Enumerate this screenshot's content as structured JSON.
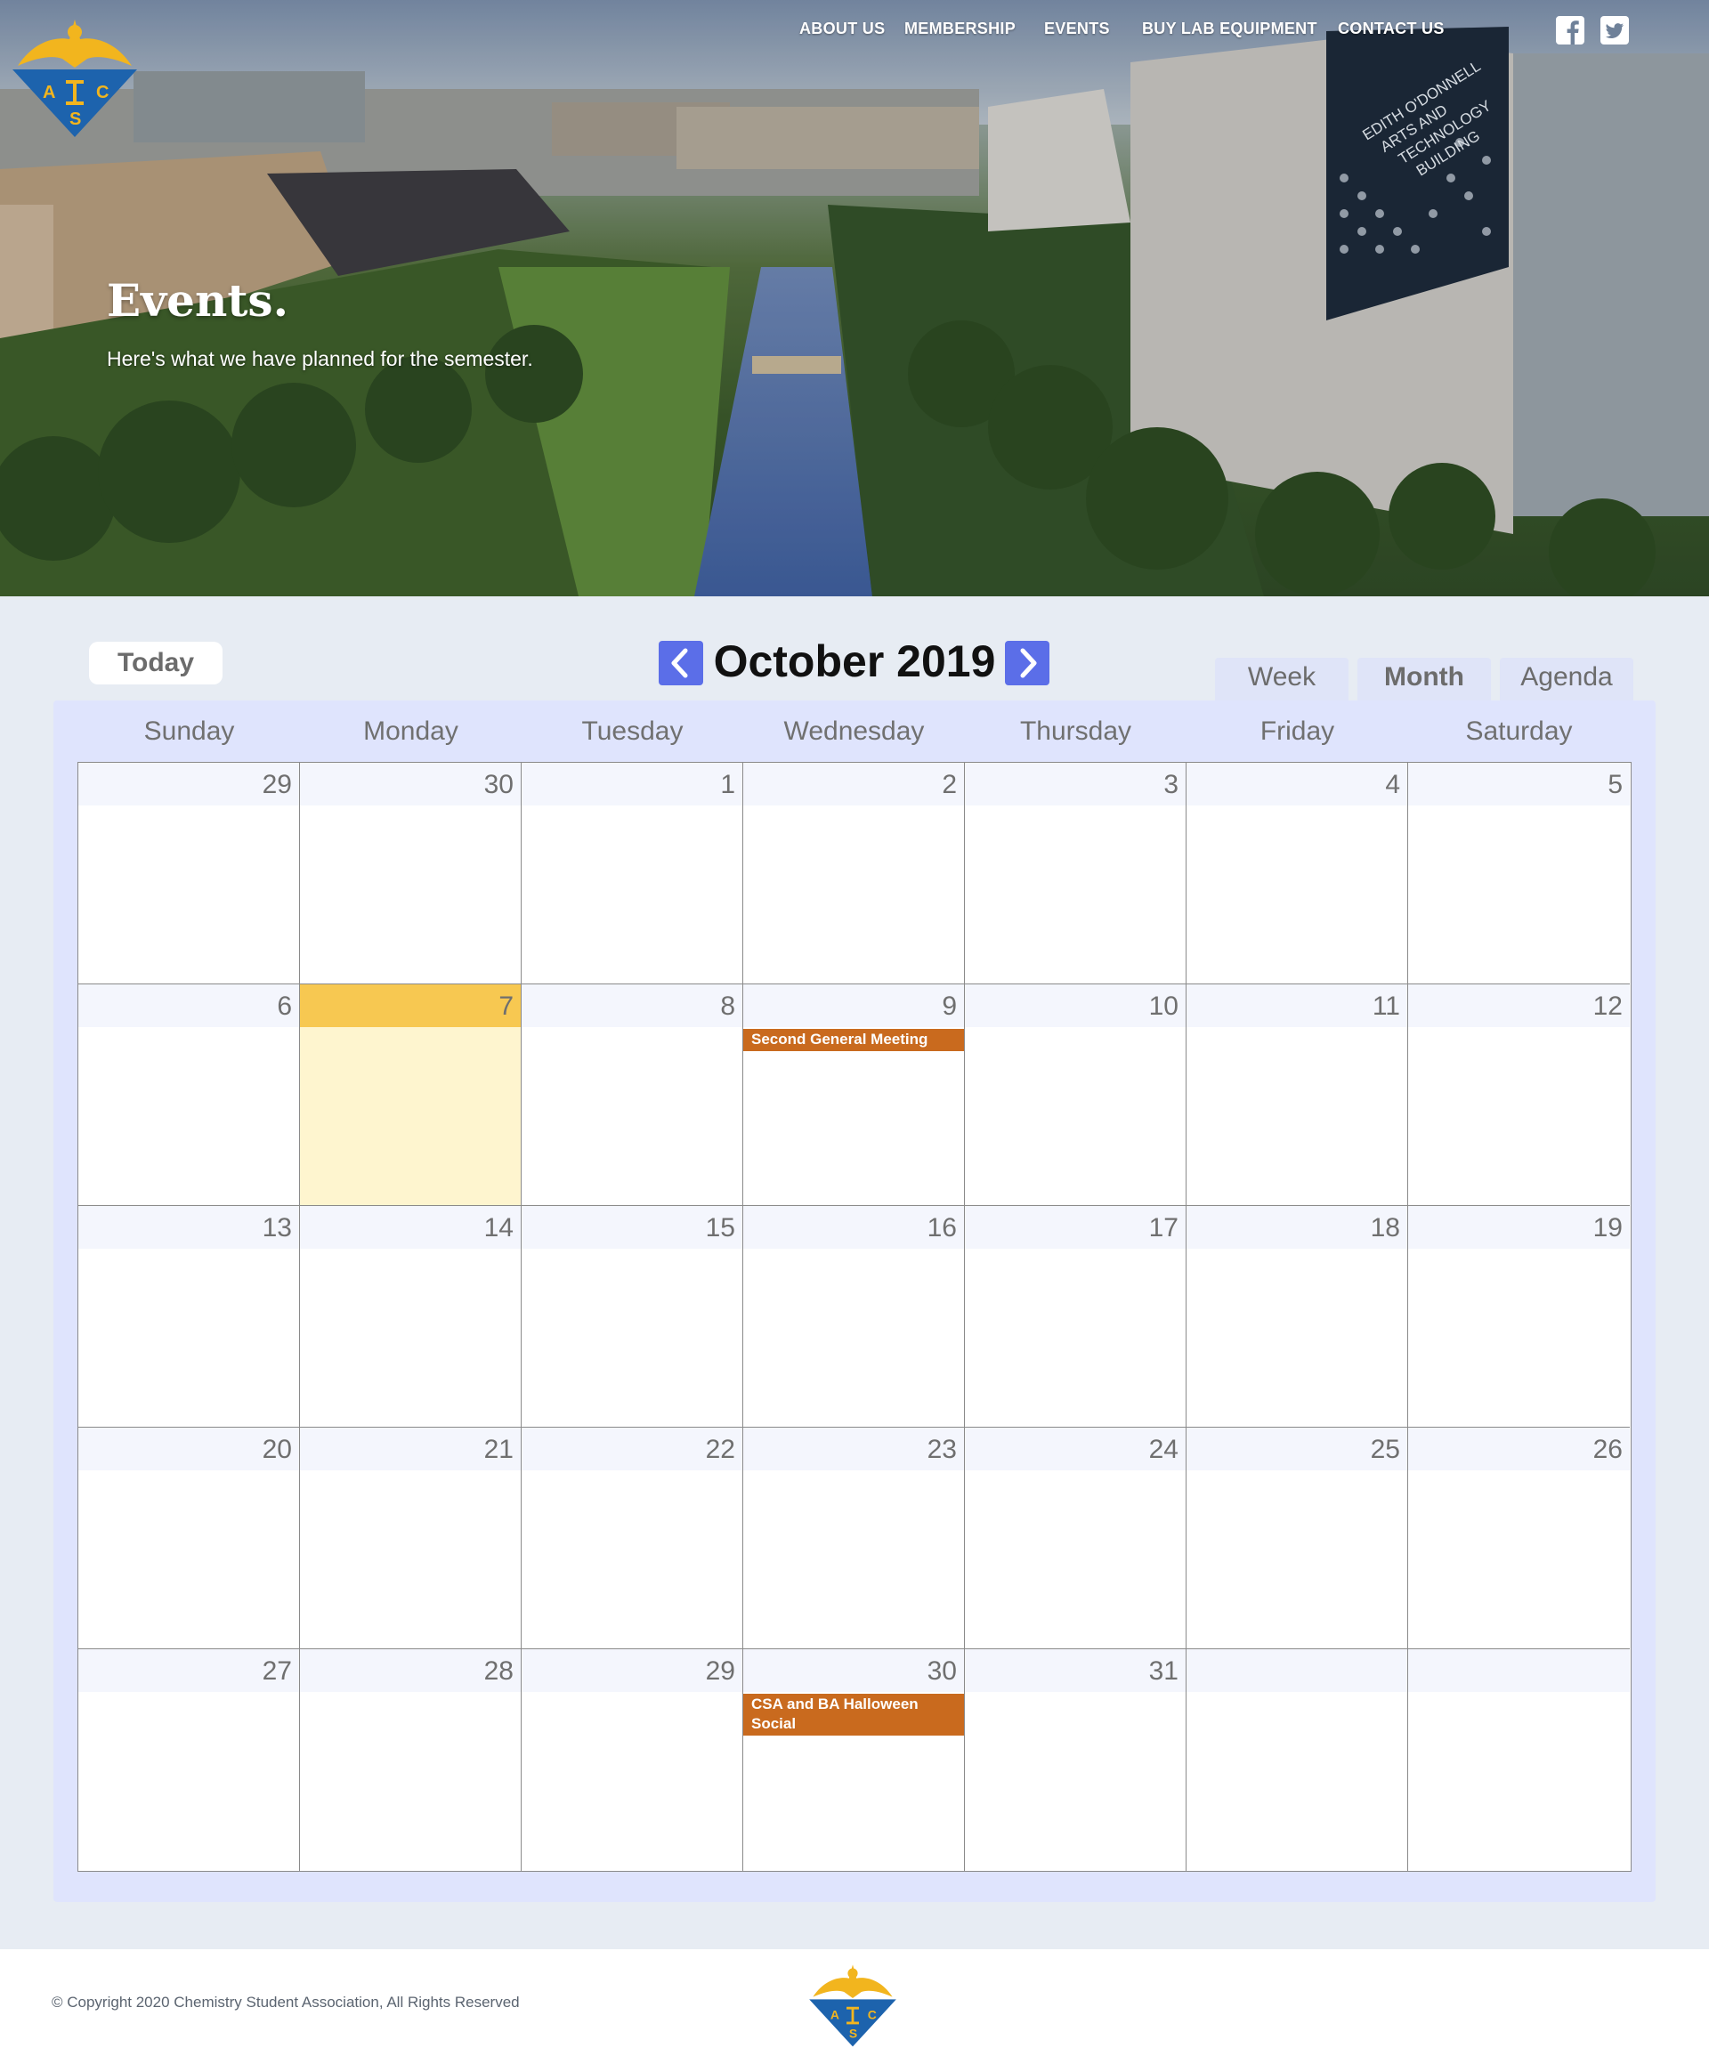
{
  "nav": {
    "items": [
      "ABOUT US",
      "MEMBERSHIP",
      "EVENTS",
      "BUY LAB EQUIPMENT",
      "CONTACT US"
    ],
    "social": [
      "facebook-icon",
      "twitter-icon"
    ],
    "logo_letters": [
      "A",
      "C",
      "S"
    ]
  },
  "hero": {
    "title": "Events.",
    "subtitle": "Here's what we have planned for the semester.",
    "sign_text": [
      "EDITH O'DONNELL",
      "ARTS AND",
      "TECHNOLOGY",
      "BUILDING"
    ]
  },
  "calendar": {
    "today_label": "Today",
    "month_title": "October 2019",
    "prev_icon": "chevron-left-icon",
    "next_icon": "chevron-right-icon",
    "views": [
      "Week",
      "Month",
      "Agenda"
    ],
    "active_view": "Month",
    "weekdays": [
      "Sunday",
      "Monday",
      "Tuesday",
      "Wednesday",
      "Thursday",
      "Friday",
      "Saturday"
    ],
    "weeks": [
      [
        {
          "day": "29"
        },
        {
          "day": "30"
        },
        {
          "day": "1"
        },
        {
          "day": "2"
        },
        {
          "day": "3"
        },
        {
          "day": "4"
        },
        {
          "day": "5"
        }
      ],
      [
        {
          "day": "6"
        },
        {
          "day": "7",
          "today": true
        },
        {
          "day": "8"
        },
        {
          "day": "9",
          "event": "Second General Meeting"
        },
        {
          "day": "10"
        },
        {
          "day": "11"
        },
        {
          "day": "12"
        }
      ],
      [
        {
          "day": "13"
        },
        {
          "day": "14"
        },
        {
          "day": "15"
        },
        {
          "day": "16"
        },
        {
          "day": "17"
        },
        {
          "day": "18"
        },
        {
          "day": "19"
        }
      ],
      [
        {
          "day": "20"
        },
        {
          "day": "21"
        },
        {
          "day": "22"
        },
        {
          "day": "23"
        },
        {
          "day": "24"
        },
        {
          "day": "25"
        },
        {
          "day": "26"
        }
      ],
      [
        {
          "day": "27"
        },
        {
          "day": "28"
        },
        {
          "day": "29"
        },
        {
          "day": "30",
          "event": "CSA and BA Halloween Social"
        },
        {
          "day": "31"
        },
        {
          "day": ""
        },
        {
          "day": ""
        }
      ]
    ],
    "colors": {
      "today_header": "#f7c851",
      "today_body": "#fef5cf",
      "event": "#c96a1e",
      "nav_arrow": "#5b6ee8",
      "panel": "#dfe4fd"
    }
  },
  "footer": {
    "copyright": "© Copyright 2020 Chemistry Student Association, All Rights Reserved"
  }
}
